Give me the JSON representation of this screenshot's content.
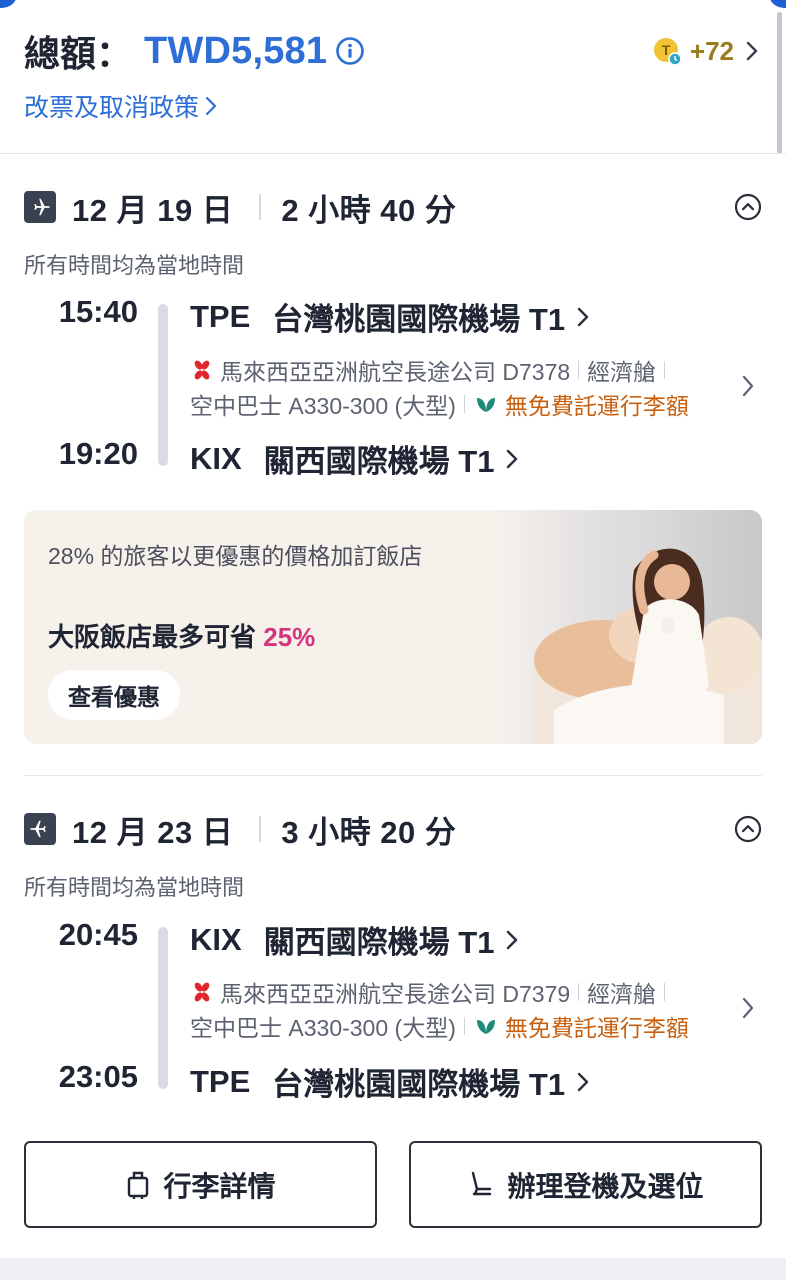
{
  "header": {
    "total_label": "總額：",
    "total_amount": "TWD5,581",
    "points_value": "+72",
    "policy_link": "改票及取消政策"
  },
  "segments": [
    {
      "date": "12 月 19 日",
      "duration": "2 小時 40 分",
      "local_note": "所有時間均為當地時間",
      "dep_time": "15:40",
      "dep_code": "TPE",
      "dep_airport": "台灣桃園國際機場 T1",
      "airline_line": "馬來西亞亞洲航空長途公司 D7378",
      "cabin": "經濟艙",
      "aircraft": "空中巴士 A330-300 (大型)",
      "baggage_note": "無免費託運行李額",
      "arr_time": "19:20",
      "arr_code": "KIX",
      "arr_airport": "關西國際機場 T1"
    },
    {
      "date": "12 月 23 日",
      "duration": "3 小時 20 分",
      "local_note": "所有時間均為當地時間",
      "dep_time": "20:45",
      "dep_code": "KIX",
      "dep_airport": "關西國際機場 T1",
      "airline_line": "馬來西亞亞洲航空長途公司 D7379",
      "cabin": "經濟艙",
      "aircraft": "空中巴士 A330-300 (大型)",
      "baggage_note": "無免費託運行李額",
      "arr_time": "23:05",
      "arr_code": "TPE",
      "arr_airport": "台灣桃園國際機場 T1"
    }
  ],
  "promo": {
    "line1": "28% 的旅客以更優惠的價格加訂飯店",
    "line2_prefix": "大阪飯店最多可省 ",
    "line2_pct": "25%",
    "button": "查看優惠"
  },
  "buttons": {
    "baggage": "行李詳情",
    "checkin": "辦理登機及選位"
  },
  "colors": {
    "accent_blue": "#2e6fd6",
    "points_gold": "#9a7c1d",
    "baggage_orange": "#c8600f",
    "promo_pink": "#d2357f",
    "airline_red": "#e3262e"
  }
}
